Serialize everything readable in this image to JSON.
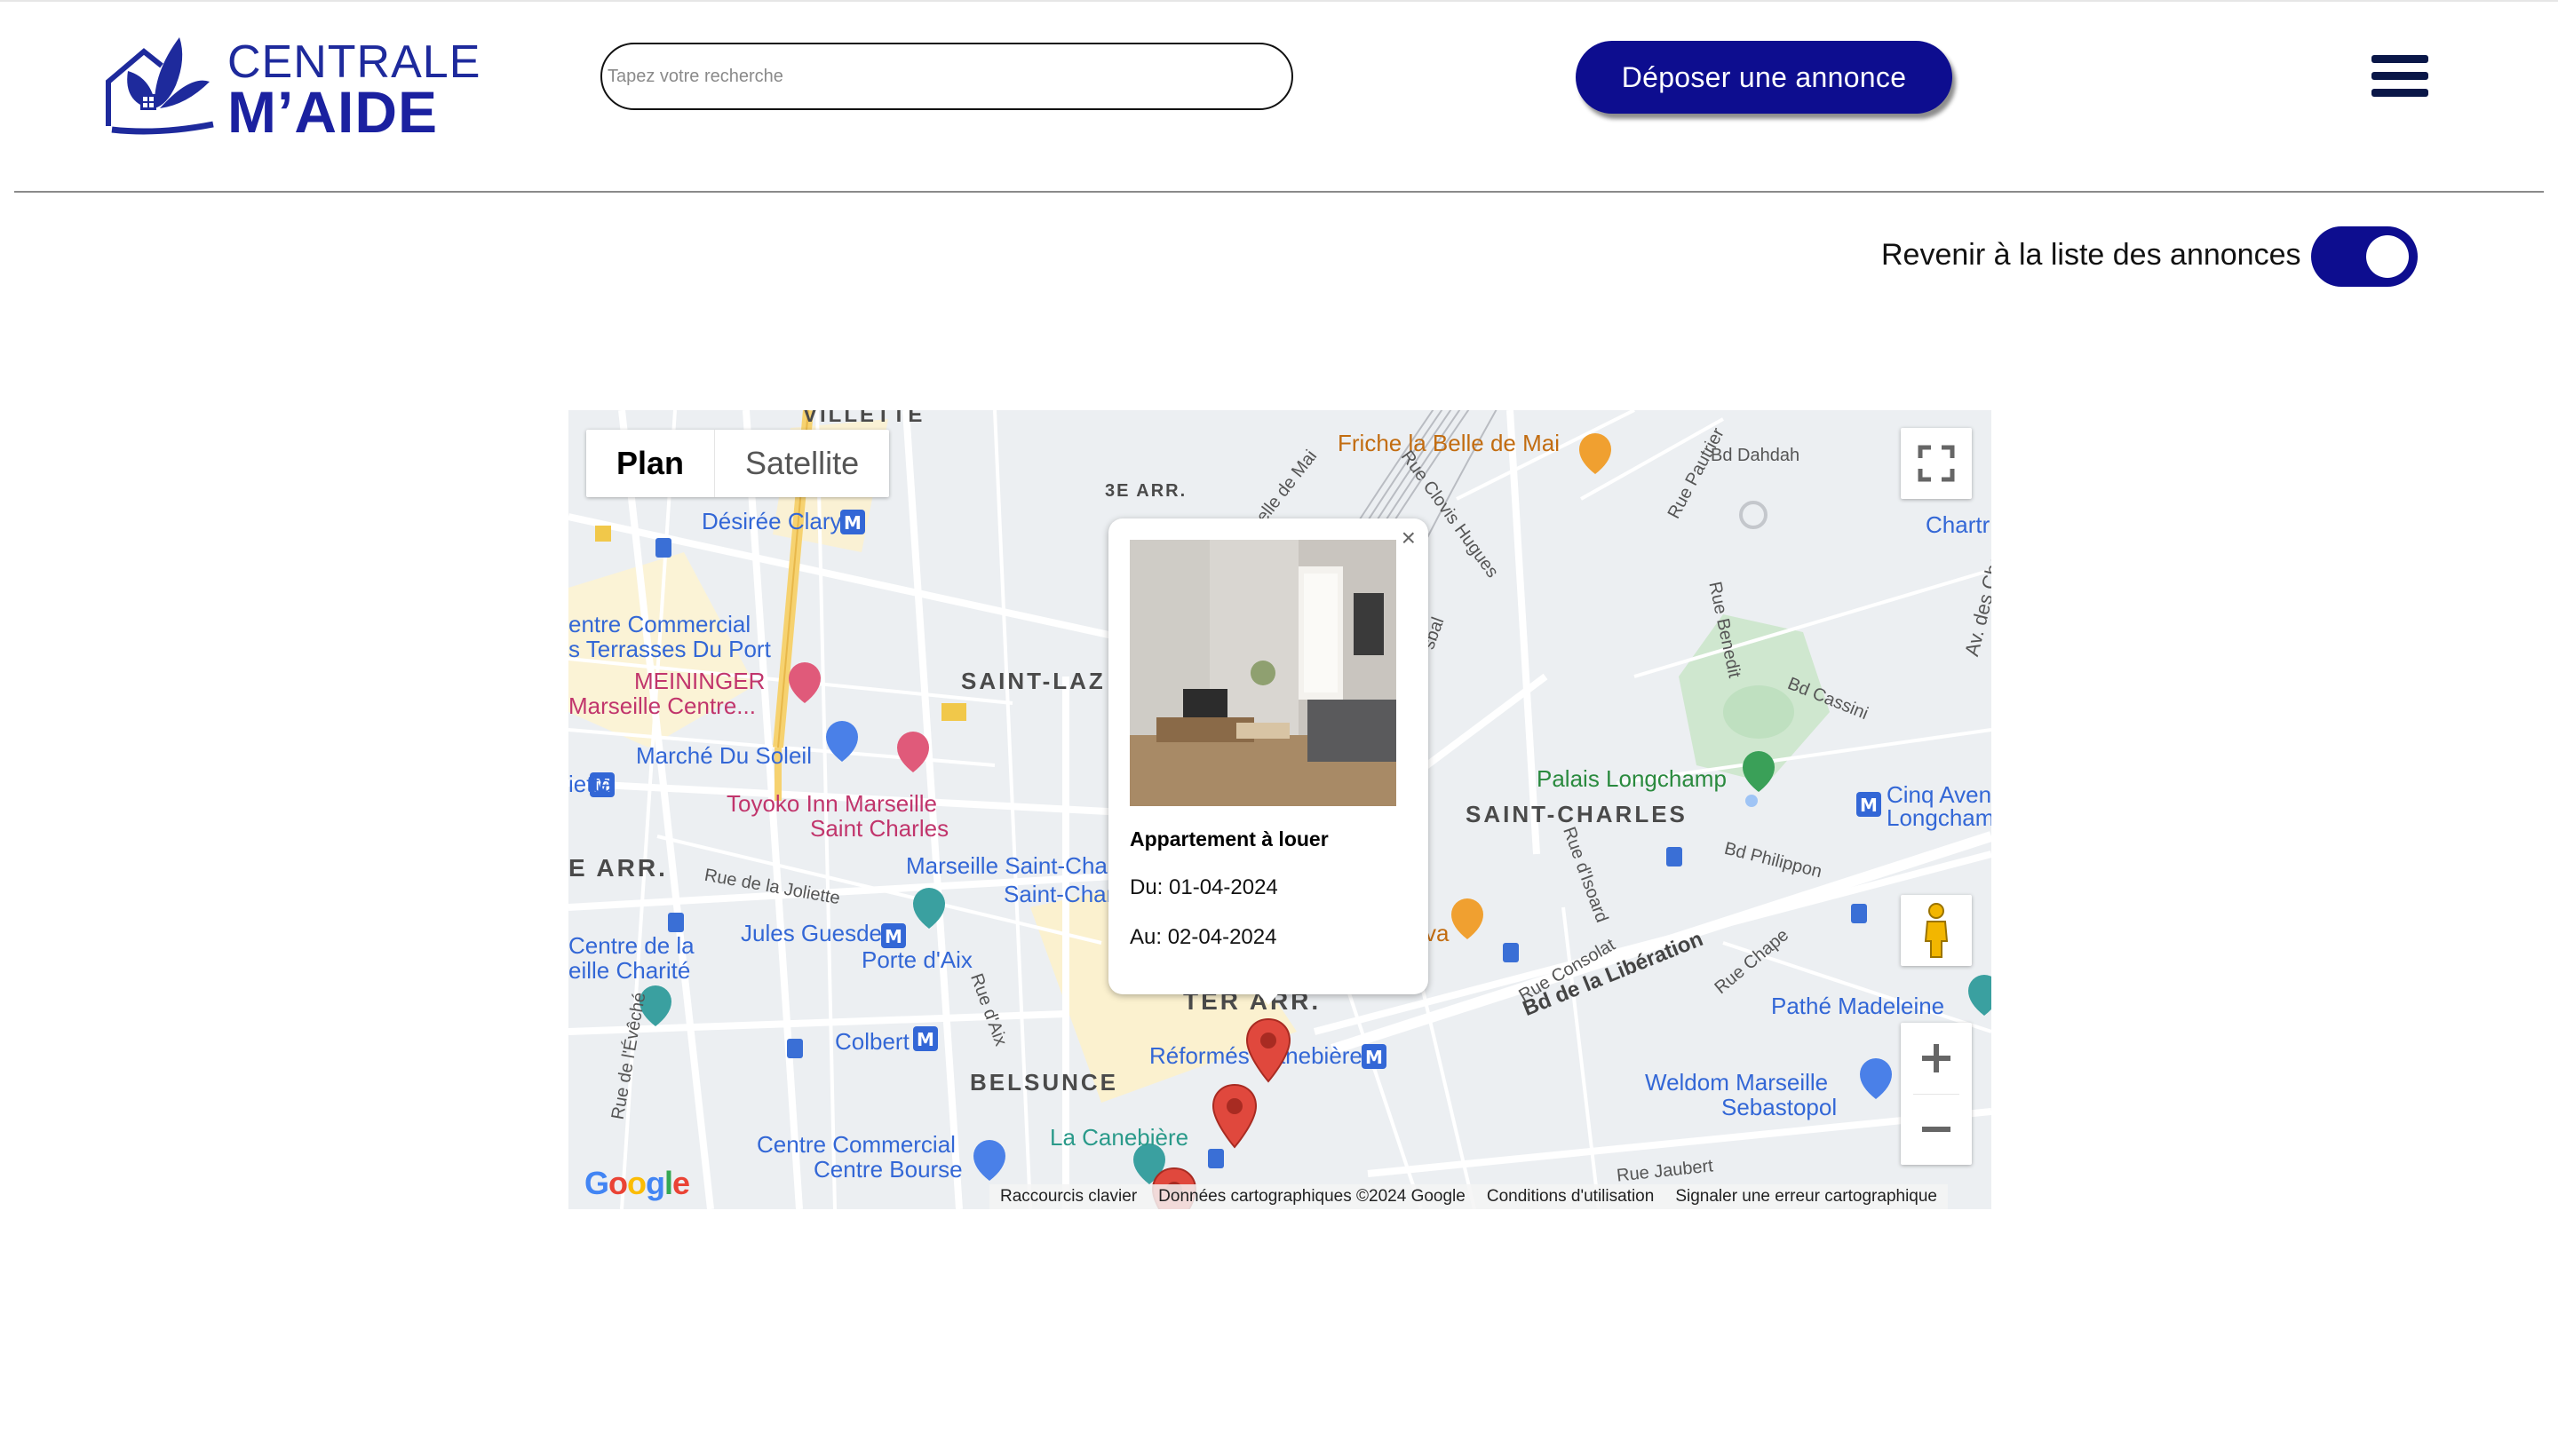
{
  "header": {
    "logo_line1": "CENTRALE",
    "logo_line2": "M’AIDE",
    "search_placeholder": "Tapez votre recherche",
    "cta_label": "Déposer une annonce"
  },
  "toggle": {
    "label": "Revenir à la liste des annonces",
    "checked": true
  },
  "map": {
    "type_buttons": {
      "plan": "Plan",
      "satellite": "Satellite"
    },
    "labels": {
      "villette": "VILLETTE",
      "arr3": "3E ARR.",
      "friche": "Friche la Belle de Mai",
      "dahdah": "Bd Dahdah",
      "chartr": "Chartr",
      "desiree": "Désirée Clary",
      "cc_line1": "entre Commercial",
      "cc_line2": "s Terrasses Du Port",
      "meininger1": "MEININGER",
      "meininger2": "Marseille Centre...",
      "saint_laz": "SAINT-LAZ",
      "marche": "Marché Du Soleil",
      "iette": "iette",
      "toyoko1": "Toyoko Inn Marseille",
      "toyoko2": "Saint Charles",
      "palais": "Palais Longchamp",
      "cinq1": "Cinq Aven",
      "cinq2": "Longcham",
      "saint_charles": "SAINT-CHARLES",
      "arr_e": "E ARR.",
      "msc1": "Marseille Saint-Char",
      "msc2": "Saint-Char",
      "jules": "Jules Guesde",
      "porte": "Porte d'Aix",
      "charite1": "Centre de la",
      "charite2": "eille Charité",
      "colbert": "Colbert",
      "ter_arr": "TER ARR.",
      "reformes": "Réformés Canebière",
      "belsunce": "BELSUNCE",
      "canebiere": "La Canebière",
      "ccb1": "Centre Commercial",
      "ccb2": "Centre Bourse",
      "pathe": "Pathé Madeleine",
      "weldom1": "Weldom Marseille",
      "weldom2": "Sebastopol",
      "liberation": "Bd de la Libération",
      "va": "va",
      "rue_joliette": "Rue de la Joliette",
      "rue_aix": "Rue d'Aix",
      "rue_eveche": "Rue de l'Évêché",
      "bd_cassini": "Bd Cassini",
      "bd_philippon": "Bd Philippon",
      "rue_consolat": "Rue Consolat",
      "rue_chape": "Rue Chape",
      "rue_jaubert": "Rue Jaubert",
      "rue_benedit": "Rue Benedit",
      "rue_pautrier": "Rue Pautrier",
      "rue_clovis": "Rue Clovis Hugues",
      "belle_mai": "Belle de Mai",
      "av_chartreux": "Av. des Chart",
      "rue_isoard": "Rue d'Isoard",
      "sbal": "sbal"
    },
    "google_logo": "Google",
    "attribution": {
      "shortcuts": "Raccourcis clavier",
      "data": "Données cartographiques ©2024 Google",
      "terms": "Conditions d'utilisation",
      "report": "Signaler une erreur cartographique"
    },
    "popup": {
      "title": "Appartement à louer",
      "from": "Du: 01-04-2024",
      "to": "Au: 02-04-2024",
      "close": "×"
    },
    "pin_color": "#e0483d"
  },
  "colors": {
    "brand": "#0d0d8f",
    "logo": "#1e2a9c"
  }
}
